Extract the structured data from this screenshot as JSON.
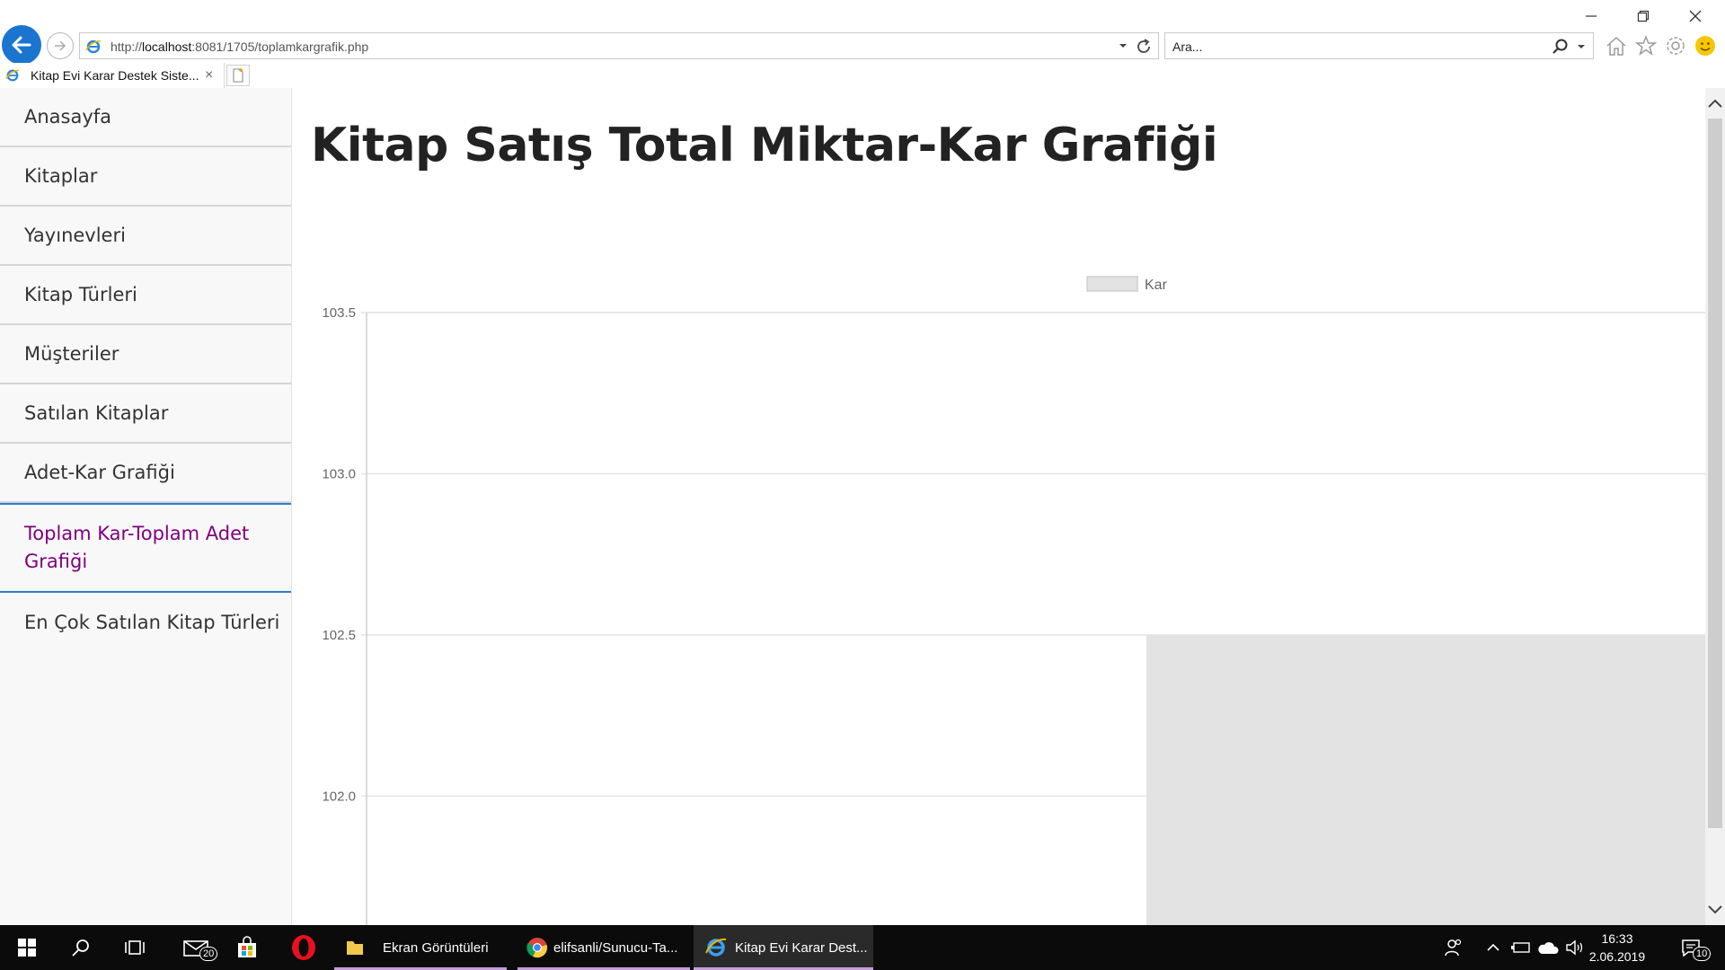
{
  "browser": {
    "url_prefix": "http://",
    "url_host": "localhost",
    "url_rest": ":8081/1705/toplamkargrafik.php",
    "search_placeholder": "Ara...",
    "tab_title": "Kitap Evi Karar Destek Siste...",
    "tab_close": "×"
  },
  "sidebar": {
    "items": [
      {
        "label": "Anasayfa"
      },
      {
        "label": "Kitaplar"
      },
      {
        "label": "Yayınevleri"
      },
      {
        "label": "Kitap Türleri"
      },
      {
        "label": "Müşteriler"
      },
      {
        "label": "Satılan Kitaplar"
      },
      {
        "label": "Adet-Kar Grafiği"
      },
      {
        "label": "Toplam Kar-Toplam Adet Grafiği"
      },
      {
        "label": "En Çok Satılan Kitap Türleri"
      }
    ],
    "active_index": 7,
    "active_color": "#800080",
    "active_border_color": "#2b7bd1"
  },
  "page": {
    "title": "Kitap Satış Total Miktar-Kar Grafiği"
  },
  "chart_data": {
    "type": "bar",
    "title": "",
    "xlabel": "",
    "ylabel": "",
    "series": [
      {
        "name": "Kar",
        "values": [
          null,
          102.5
        ],
        "color": "#e3e3e3"
      }
    ],
    "categories": [
      "",
      ""
    ],
    "y_ticks": [
      "103.5",
      "103.0",
      "102.5",
      "102.0"
    ],
    "ylim": [
      101.6,
      103.5
    ],
    "legend_position": "top",
    "grid": true
  },
  "taskbar": {
    "apps": [
      {
        "label": "Ekran Görüntüleri"
      },
      {
        "label": "elifsanli/Sunucu-Ta..."
      },
      {
        "label": "Kitap Evi Karar Dest..."
      }
    ],
    "mail_badge": "20",
    "notification_badge": "10",
    "time": "16:33",
    "date": "2.06.2019"
  }
}
